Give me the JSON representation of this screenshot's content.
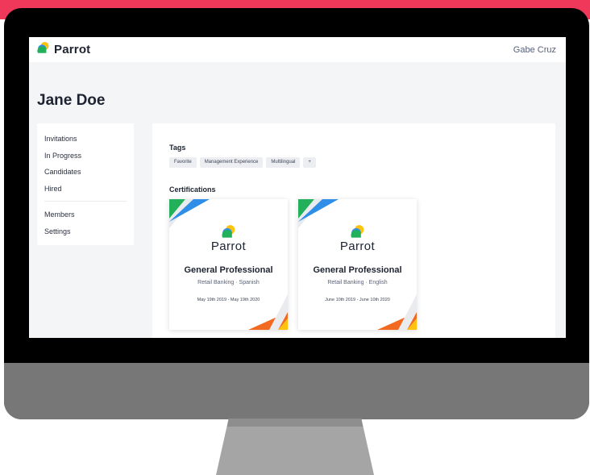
{
  "app": {
    "brand": "Parrot",
    "user": "Gabe Cruz"
  },
  "page": {
    "title": "Jane Doe"
  },
  "sidebar": {
    "group1": [
      {
        "label": "Invitations"
      },
      {
        "label": "In Progress"
      },
      {
        "label": "Candidates"
      },
      {
        "label": "Hired"
      }
    ],
    "group2": [
      {
        "label": "Members"
      },
      {
        "label": "Settings"
      }
    ]
  },
  "tags": {
    "title": "Tags",
    "items": [
      "Favorite",
      "Management Experience",
      "Multilingual",
      "+"
    ]
  },
  "certifications": {
    "title": "Certifications",
    "items": [
      {
        "brand": "Parrot",
        "title": "General Professional",
        "subtitle": "Retail Banking · Spanish",
        "dates": "May 19th 2019 - May 19th 2020"
      },
      {
        "brand": "Parrot",
        "title": "General Professional",
        "subtitle": "Retail Banking · English",
        "dates": "June 10th 2019 - June 10th 2020"
      }
    ]
  },
  "colors": {
    "accent_band": "#f0385a",
    "logo_green": "#22b15a",
    "logo_blue": "#2f8fe8",
    "logo_yellow": "#ffc20e",
    "deco_orange": "#f26a21"
  },
  "icons": {
    "logo": "parrot-logo-icon"
  }
}
